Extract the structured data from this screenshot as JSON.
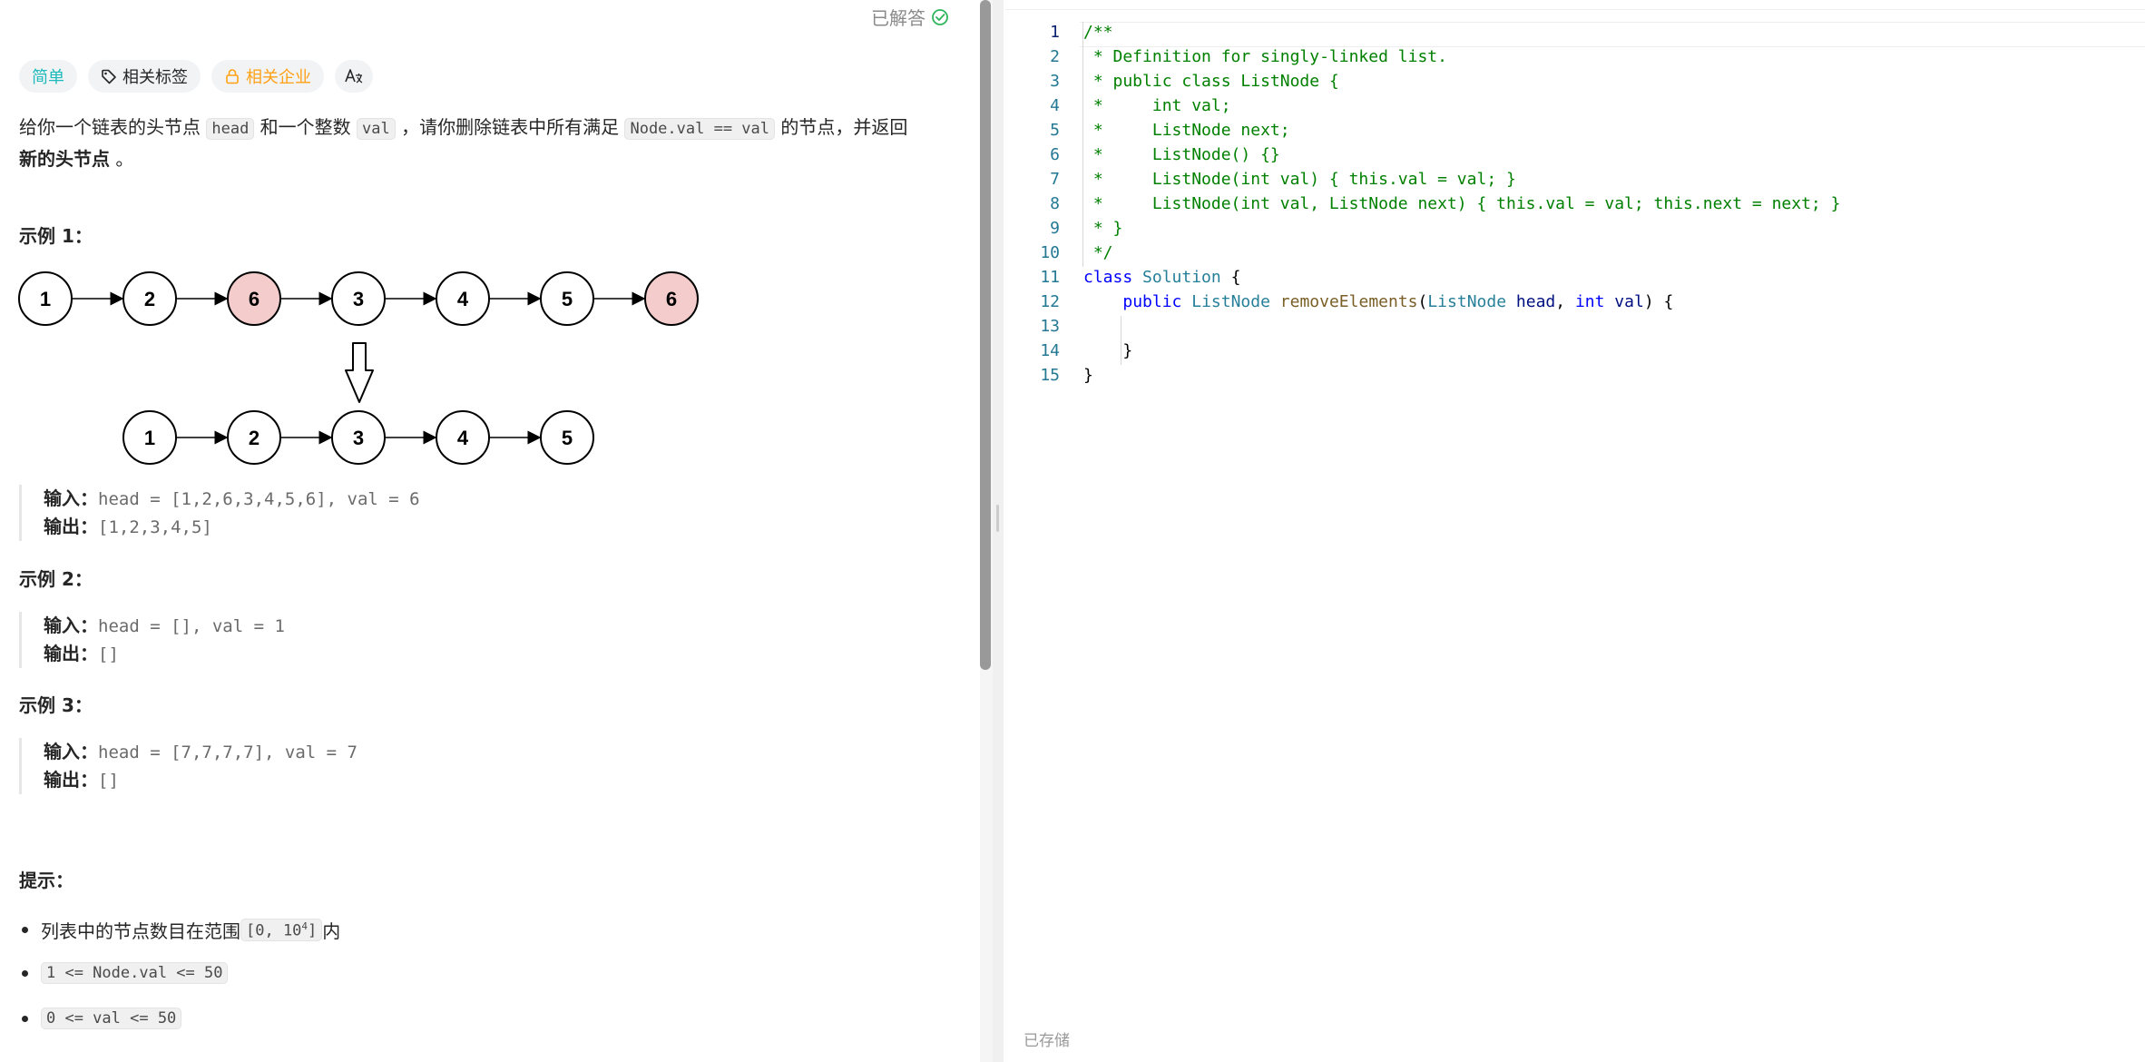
{
  "header": {
    "solved_label": "已解答"
  },
  "tags": {
    "difficulty": "简单",
    "related_tags": "相关标签",
    "related_companies": "相关企业",
    "translate_icon_text": "A文"
  },
  "description": {
    "part1": "给你一个链表的头节点 ",
    "code_head": "head",
    "part2": " 和一个整数 ",
    "code_val": "val",
    "part3": " ，请你删除链表中所有满足 ",
    "code_cond": "Node.val == val",
    "part4": " 的节点，并返回 ",
    "bold_end": "新的头节点",
    "part5": " 。"
  },
  "examples": [
    {
      "title": "示例 1：",
      "input_label": "输入：",
      "input_value": "head = [1,2,6,3,4,5,6], val = 6",
      "output_label": "输出：",
      "output_value": "[1,2,3,4,5]"
    },
    {
      "title": "示例 2：",
      "input_label": "输入：",
      "input_value": "head = [], val = 1",
      "output_label": "输出：",
      "output_value": "[]"
    },
    {
      "title": "示例 3：",
      "input_label": "输入：",
      "input_value": "head = [7,7,7,7], val = 7",
      "output_label": "输出：",
      "output_value": "[]"
    }
  ],
  "diagram": {
    "top_row": [
      "1",
      "2",
      "6",
      "3",
      "4",
      "5",
      "6"
    ],
    "top_removed": [
      false,
      false,
      true,
      false,
      false,
      false,
      true
    ],
    "bottom_row": [
      "1",
      "2",
      "3",
      "4",
      "5"
    ],
    "removed_fill": "#f4cccc"
  },
  "hints": {
    "title": "提示：",
    "item1_text": "列表中的节点数目在范围 ",
    "item1_code": "[0, 10",
    "item1_sup": "4",
    "item1_code_end": "]",
    "item1_after": " 内",
    "item2_code": "1 <= Node.val <= 50",
    "item3_code": "0 <= val <= 50"
  },
  "editor": {
    "saved_label": "已存储",
    "lines": [
      {
        "n": "1",
        "t": "/**"
      },
      {
        "n": "2",
        "t": " * Definition for singly-linked list."
      },
      {
        "n": "3",
        "t": " * public class ListNode {"
      },
      {
        "n": "4",
        "t": " *     int val;"
      },
      {
        "n": "5",
        "t": " *     ListNode next;"
      },
      {
        "n": "6",
        "t": " *     ListNode() {}"
      },
      {
        "n": "7",
        "t": " *     ListNode(int val) { this.val = val; }"
      },
      {
        "n": "8",
        "t": " *     ListNode(int val, ListNode next) { this.val = val; this.next = next; }"
      },
      {
        "n": "9",
        "t": " * }"
      },
      {
        "n": "10",
        "t": " */"
      },
      {
        "n": "11",
        "t": "class Solution {"
      },
      {
        "n": "12",
        "t": "    public ListNode removeElements(ListNode head, int val) {"
      },
      {
        "n": "13",
        "t": ""
      },
      {
        "n": "14",
        "t": "    }"
      },
      {
        "n": "15",
        "t": "}"
      }
    ]
  },
  "colors": {
    "difficulty_easy": "#1cbaba",
    "company_tag": "#ffa116",
    "solved_check": "#2db55d"
  }
}
